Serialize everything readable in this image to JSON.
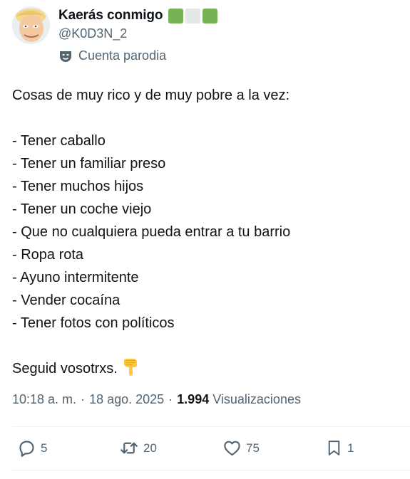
{
  "author": {
    "display_name": "Kaerás conmigo",
    "flag_colors": [
      "#77b255",
      "#e6e7e8",
      "#77b255"
    ],
    "handle": "@K0D3N_2",
    "parody_label": "Cuenta parodia",
    "parody_icon": "theater-mask-icon"
  },
  "tweet": {
    "lines": [
      "Cosas de muy rico y de muy pobre a la vez:",
      "",
      "- Tener caballo",
      "- Tener un familiar preso",
      "- Tener muchos hijos",
      "- Tener un coche viejo",
      "- Que no cualquiera pueda entrar a tu barrio",
      "- Ropa rota",
      "- Ayuno intermitente",
      "- Vender cocaína",
      "- Tener fotos con políticos",
      "",
      "Seguid vosotrxs."
    ],
    "closing_emoji": "pointing-down-hand-icon"
  },
  "meta": {
    "time": "10:18 a. m.",
    "separator": "·",
    "date": "18 ago. 2025",
    "views_count": "1.994",
    "views_label": "Visualizaciones"
  },
  "actions": {
    "replies": "5",
    "retweets": "20",
    "likes": "75",
    "bookmarks": "1"
  },
  "colors": {
    "text": "#0f1419",
    "secondary": "#536471",
    "divider": "#eff3f4"
  }
}
